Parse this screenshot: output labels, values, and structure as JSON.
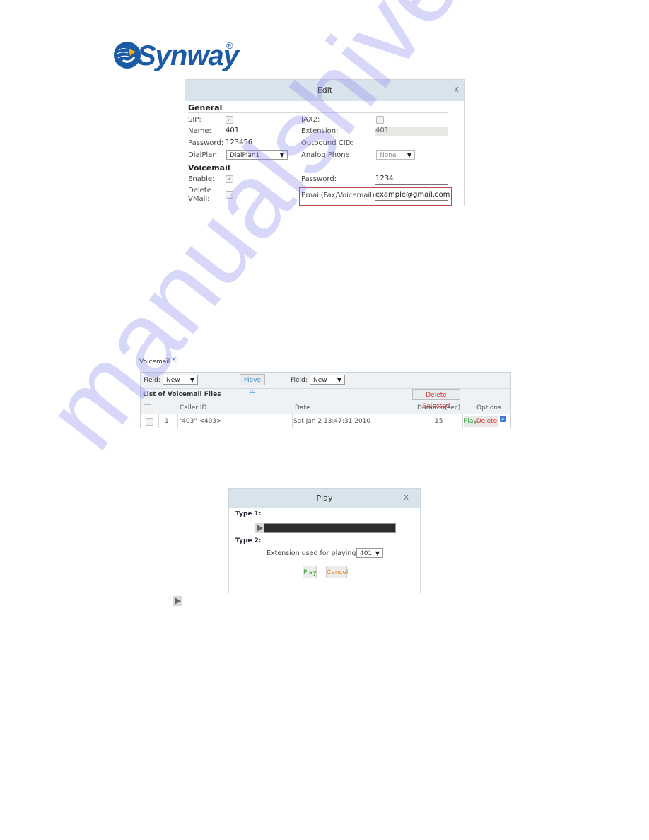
{
  "brand": {
    "name": "Synway",
    "registered": "®",
    "color": "#1a5aa6"
  },
  "watermark": "manualshive.com",
  "edit_dialog": {
    "title": "Edit",
    "close": "X",
    "general": {
      "title": "General",
      "sip_label": "SIP:",
      "sip_checked": true,
      "iax2_label": "IAX2:",
      "iax2_checked": false,
      "name_label": "Name:",
      "name_value": "401",
      "extension_label": "Extension:",
      "extension_value": "401",
      "password_label": "Password:",
      "password_value": "123456",
      "outbound_cid_label": "Outbound CID:",
      "outbound_cid_value": "",
      "dialplan_label": "DialPlan:",
      "dialplan_value": "DialPlan1",
      "analog_phone_label": "Analog Phone:",
      "analog_phone_value": "None"
    },
    "voicemail": {
      "title": "Voicemail",
      "enable_label": "Enable:",
      "enable_checked": true,
      "password_label": "Password:",
      "password_value": "1234",
      "delete_vmail_label_1": "Delete",
      "delete_vmail_label_2": "VMail:",
      "delete_vmail_checked": false,
      "email_label": "Email(Fax/Voicemail):",
      "email_value": "example@gmail.com",
      "highlight_color": "#b44a4a"
    }
  },
  "voicemail_panel": {
    "title": "Voicemail",
    "refresh_icon": "⟲",
    "field_label_1": "Field:",
    "field_value_1": "New",
    "move_to_label": "Move to",
    "field_label_2": "Field:",
    "field_value_2": "New",
    "list_title": "List of Voicemail Files",
    "delete_selected_label": "Delete Selected",
    "columns": [
      "Caller ID",
      "Date",
      "Duration(sec)",
      "Options"
    ],
    "rows": [
      {
        "index": "1",
        "caller_id": "\"403\" <403>",
        "date": "Sat Jan 2 13:47:31 2010",
        "duration": "15",
        "play_label": "Play",
        "delete_label": "Delete"
      }
    ]
  },
  "play_dialog": {
    "title": "Play",
    "close": "X",
    "type1_label": "Type 1:",
    "type2_label": "Type 2:",
    "extension_label": "Extension used for playing:",
    "extension_value": "401",
    "play_label": "Play",
    "cancel_label": "Cancel",
    "play_color": "#3a9a3a",
    "cancel_color": "#e08a20"
  }
}
